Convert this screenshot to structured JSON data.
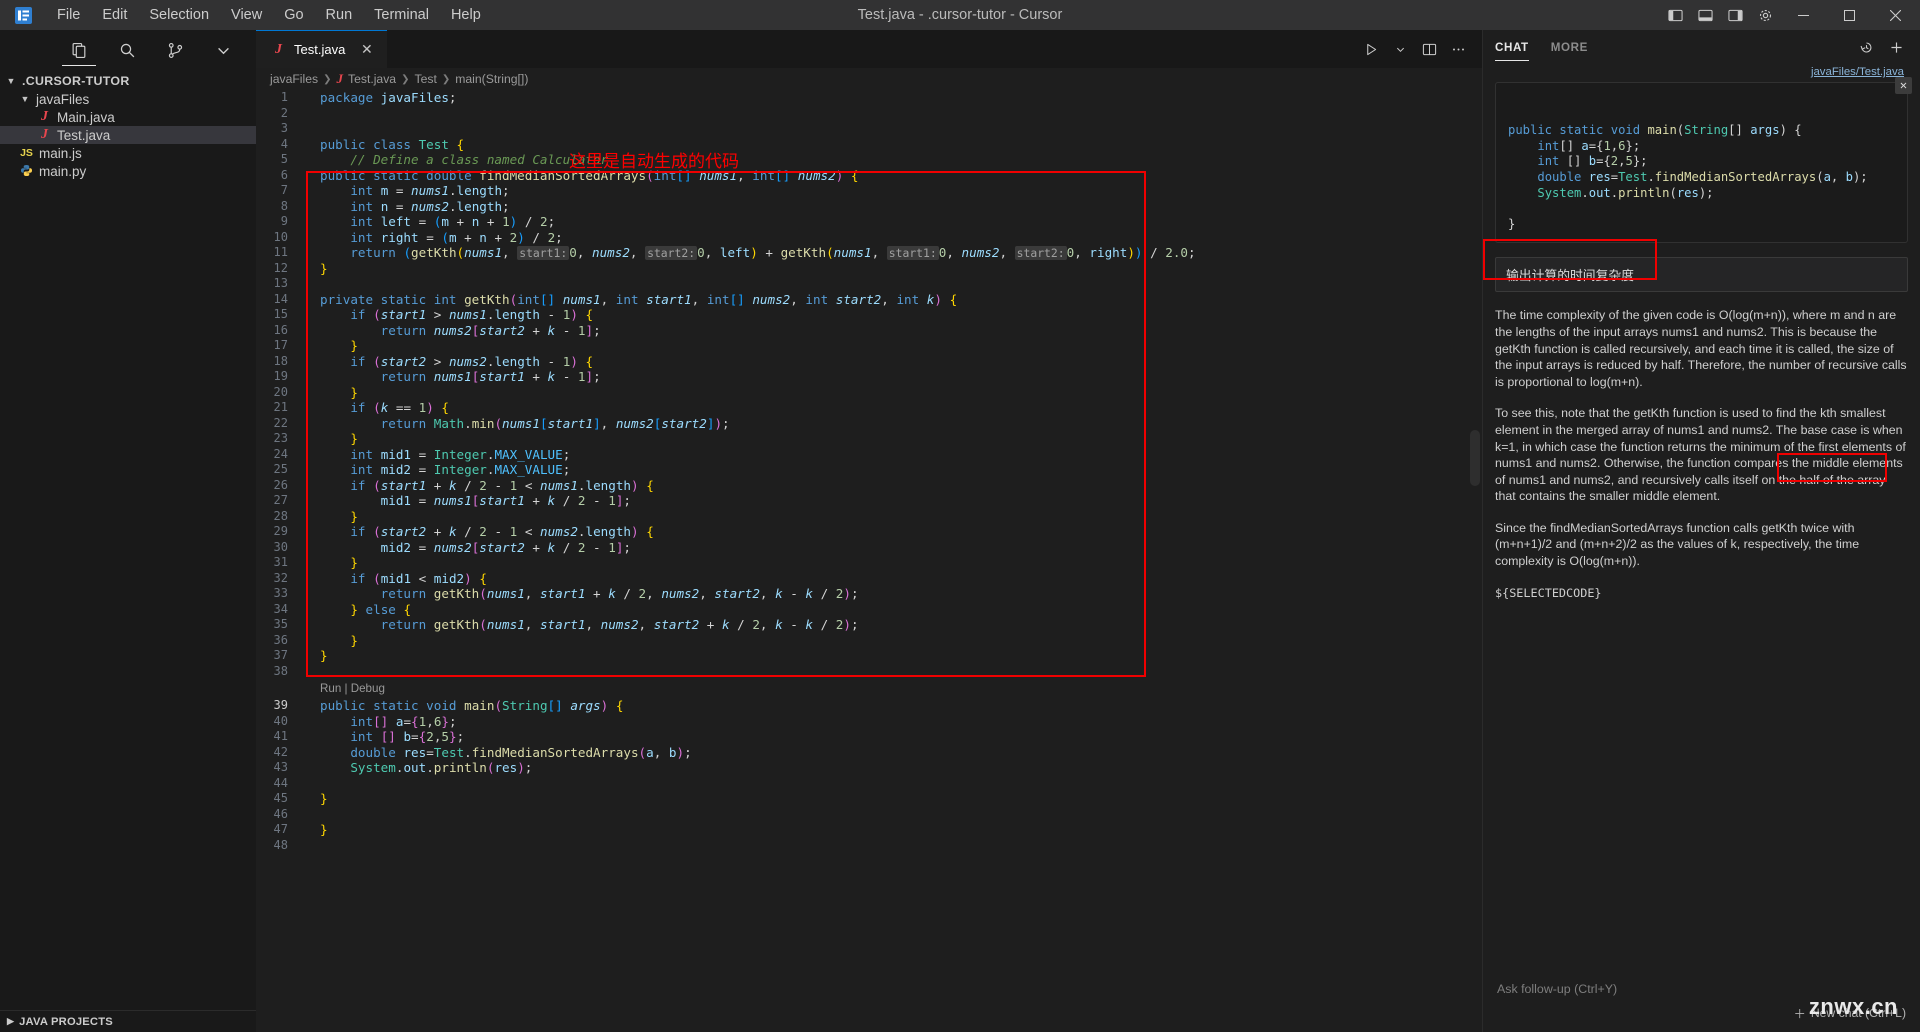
{
  "titlebar": {
    "menus": [
      "File",
      "Edit",
      "Selection",
      "View",
      "Go",
      "Run",
      "Terminal",
      "Help"
    ],
    "title": "Test.java - .cursor-tutor - Cursor"
  },
  "sidebar": {
    "toolbar_icons": [
      "explorer-icon",
      "search-icon",
      "source-control-icon",
      "more-views-icon"
    ],
    "root": ".CURSOR-TUTOR",
    "tree": [
      {
        "label": "javaFiles",
        "kind": "folder",
        "indent": 1
      },
      {
        "label": "Main.java",
        "kind": "java",
        "indent": 2
      },
      {
        "label": "Test.java",
        "kind": "java",
        "indent": 2,
        "selected": true
      },
      {
        "label": "main.js",
        "kind": "js",
        "indent": 1
      },
      {
        "label": "main.py",
        "kind": "py",
        "indent": 1
      }
    ],
    "bottom_panel": "JAVA PROJECTS"
  },
  "editor": {
    "tab": {
      "label": "Test.java",
      "icon": "java-file-icon"
    },
    "breadcrumb": [
      "javaFiles",
      "Test.java",
      "Test",
      "main(String[])"
    ],
    "codelens": "Run | Debug",
    "annotation_note": "这里是自动生成的代码",
    "lines": [
      {
        "n": 1,
        "text": "package javaFiles;"
      },
      {
        "n": 2,
        "text": ""
      },
      {
        "n": 3,
        "text": ""
      },
      {
        "n": 4,
        "text": "public class Test {"
      },
      {
        "n": 5,
        "text": "    // Define a class named Calculator"
      },
      {
        "n": 6,
        "text": "public static double findMedianSortedArrays(int[] nums1, int[] nums2) {"
      },
      {
        "n": 7,
        "text": "    int m = nums1.length;"
      },
      {
        "n": 8,
        "text": "    int n = nums2.length;"
      },
      {
        "n": 9,
        "text": "    int left = (m + n + 1) / 2;"
      },
      {
        "n": 10,
        "text": "    int right = (m + n + 2) / 2;"
      },
      {
        "n": 11,
        "text": "    return (getKth(nums1, start1:0, nums2, start2:0, left) + getKth(nums1, start1:0, nums2, start2:0, right)) / 2.0;"
      },
      {
        "n": 12,
        "text": "}"
      },
      {
        "n": 13,
        "text": ""
      },
      {
        "n": 14,
        "text": "private static int getKth(int[] nums1, int start1, int[] nums2, int start2, int k) {"
      },
      {
        "n": 15,
        "text": "    if (start1 > nums1.length - 1) {"
      },
      {
        "n": 16,
        "text": "        return nums2[start2 + k - 1];"
      },
      {
        "n": 17,
        "text": "    }"
      },
      {
        "n": 18,
        "text": "    if (start2 > nums2.length - 1) {"
      },
      {
        "n": 19,
        "text": "        return nums1[start1 + k - 1];"
      },
      {
        "n": 20,
        "text": "    }"
      },
      {
        "n": 21,
        "text": "    if (k == 1) {"
      },
      {
        "n": 22,
        "text": "        return Math.min(nums1[start1], nums2[start2]);"
      },
      {
        "n": 23,
        "text": "    }"
      },
      {
        "n": 24,
        "text": "    int mid1 = Integer.MAX_VALUE;"
      },
      {
        "n": 25,
        "text": "    int mid2 = Integer.MAX_VALUE;"
      },
      {
        "n": 26,
        "text": "    if (start1 + k / 2 - 1 < nums1.length) {"
      },
      {
        "n": 27,
        "text": "        mid1 = nums1[start1 + k / 2 - 1];"
      },
      {
        "n": 28,
        "text": "    }"
      },
      {
        "n": 29,
        "text": "    if (start2 + k / 2 - 1 < nums2.length) {"
      },
      {
        "n": 30,
        "text": "        mid2 = nums2[start2 + k / 2 - 1];"
      },
      {
        "n": 31,
        "text": "    }"
      },
      {
        "n": 32,
        "text": "    if (mid1 < mid2) {"
      },
      {
        "n": 33,
        "text": "        return getKth(nums1, start1 + k / 2, nums2, start2, k - k / 2);"
      },
      {
        "n": 34,
        "text": "    } else {"
      },
      {
        "n": 35,
        "text": "        return getKth(nums1, start1, nums2, start2 + k / 2, k - k / 2);"
      },
      {
        "n": 36,
        "text": "    }"
      },
      {
        "n": 37,
        "text": "}"
      },
      {
        "n": 38,
        "text": ""
      },
      {
        "n": 39,
        "text": "public static void main(String[] args) {"
      },
      {
        "n": 40,
        "text": "    int[] a={1,6};"
      },
      {
        "n": 41,
        "text": "    int [] b={2,5};"
      },
      {
        "n": 42,
        "text": "    double res=Test.findMedianSortedArrays(a, b);"
      },
      {
        "n": 43,
        "text": "    System.out.println(res);"
      },
      {
        "n": 44,
        "text": ""
      },
      {
        "n": 45,
        "text": "}"
      },
      {
        "n": 46,
        "text": ""
      },
      {
        "n": 47,
        "text": "}"
      },
      {
        "n": 48,
        "text": ""
      }
    ]
  },
  "chat": {
    "tabs": [
      {
        "label": "CHAT",
        "active": true
      },
      {
        "label": "MORE",
        "active": false
      }
    ],
    "file_reference": "javaFiles/Test.java",
    "code_context": [
      "public static void main(String[] args) {",
      "    int[] a={1,6};",
      "    int [] b={2,5};",
      "    double res=Test.findMedianSortedArrays(a, b);",
      "    System.out.println(res);",
      "",
      "}"
    ],
    "user_message": "输出计算的时间复杂度",
    "response_paragraphs": [
      "The time complexity of the given code is O(log(m+n)), where m and n are the lengths of the input arrays nums1 and nums2. This is because the getKth function is called recursively, and each time it is called, the size of the input arrays is reduced by half. Therefore, the number of recursive calls is proportional to log(m+n).",
      "To see this, note that the getKth function is used to find the kth smallest element in the merged array of nums1 and nums2. The base case is when k=1, in which case the function returns the minimum of the first elements of nums1 and nums2. Otherwise, the function compares the middle elements of nums1 and nums2, and recursively calls itself on the half of the array that contains the smaller middle element.",
      "Since the findMedianSortedArrays function calls getKth twice with (m+n+1)/2 and (m+n+2)/2 as the values of k, respectively, the time complexity is O(log(m+n))."
    ],
    "selected_code_token": "${SELECTEDCODE}",
    "input_placeholder": "Ask follow-up (Ctrl+Y)",
    "new_chat_label": "New chat (Ctrl+L)",
    "close_icon": "close-icon"
  },
  "watermark": "znwx.cn",
  "colors": {
    "annotation_red": "#f00000",
    "accent_blue": "#0078d4",
    "editor_bg": "#1e1e1e",
    "sidebar_bg": "#191919",
    "titlebar_bg": "#323233"
  }
}
